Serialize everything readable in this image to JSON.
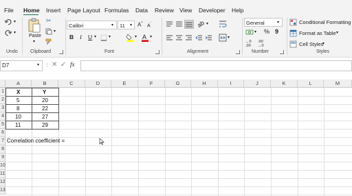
{
  "menu": {
    "tabs": [
      "File",
      "Home",
      "Insert",
      "Page Layout",
      "Formulas",
      "Data",
      "Review",
      "View",
      "Developer",
      "Help"
    ],
    "active": "Home"
  },
  "ribbon": {
    "groups": {
      "undo": "Undo",
      "clipboard": "Clipboard",
      "font": "Font",
      "alignment": "Alignment",
      "number": "Number",
      "styles": "Styles"
    },
    "paste_label": "Paste",
    "font_name": "Calibri",
    "font_size": "11",
    "number_format": "General",
    "styles_buttons": {
      "conditional": "Conditional Formatting",
      "format_table": "Format as Table",
      "cell_styles": "Cell Styles"
    },
    "accent_color": "#217346",
    "highlight_color": "#ffff00",
    "font_color": "#e00000"
  },
  "formula_bar": {
    "name_box": "D7",
    "fx": "fx",
    "formula": ""
  },
  "sheet": {
    "columns": [
      "A",
      "B",
      "C",
      "D",
      "E",
      "F",
      "G",
      "H",
      "I",
      "J",
      "K",
      "L",
      "M"
    ],
    "rows": [
      "1",
      "2",
      "3",
      "4",
      "5",
      "6",
      "7",
      "8",
      "9",
      "10",
      "11",
      "12",
      "13"
    ],
    "header_x": "X",
    "header_y": "Y",
    "x_values": [
      "5",
      "8",
      "10",
      "11"
    ],
    "y_values": [
      "20",
      "22",
      "27",
      "29"
    ],
    "correlation_label": "Correlation coefficient ="
  }
}
